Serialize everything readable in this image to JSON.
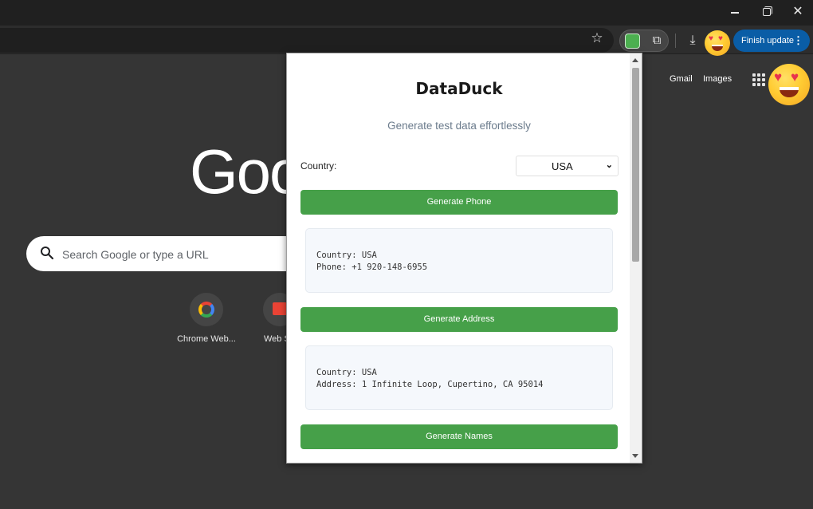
{
  "browser": {
    "finish_update_label": "Finish update",
    "ntp_links": {
      "gmail": "Gmail",
      "images": "Images"
    },
    "google_logo_text": "Goo",
    "search_placeholder": "Search Google or type a URL",
    "shortcuts": [
      {
        "label": "Chrome Web..."
      },
      {
        "label": "Web S"
      }
    ]
  },
  "popup": {
    "title": "DataDuck",
    "subtitle": "Generate test data effortlessly",
    "country_label": "Country:",
    "country_selected": "USA",
    "buttons": {
      "phone": "Generate Phone",
      "address": "Generate Address",
      "names": "Generate Names"
    },
    "results": {
      "phone": {
        "line1": "Country: USA",
        "line2": "Phone: +1 920-148-6955"
      },
      "address": {
        "line1": "Country: USA",
        "line2": "Address: 1 Infinite Loop, Cupertino, CA 95014"
      }
    }
  },
  "colors": {
    "button_green": "#46a049",
    "finish_update_blue": "#0a5da6",
    "ntp_background": "#353535"
  }
}
